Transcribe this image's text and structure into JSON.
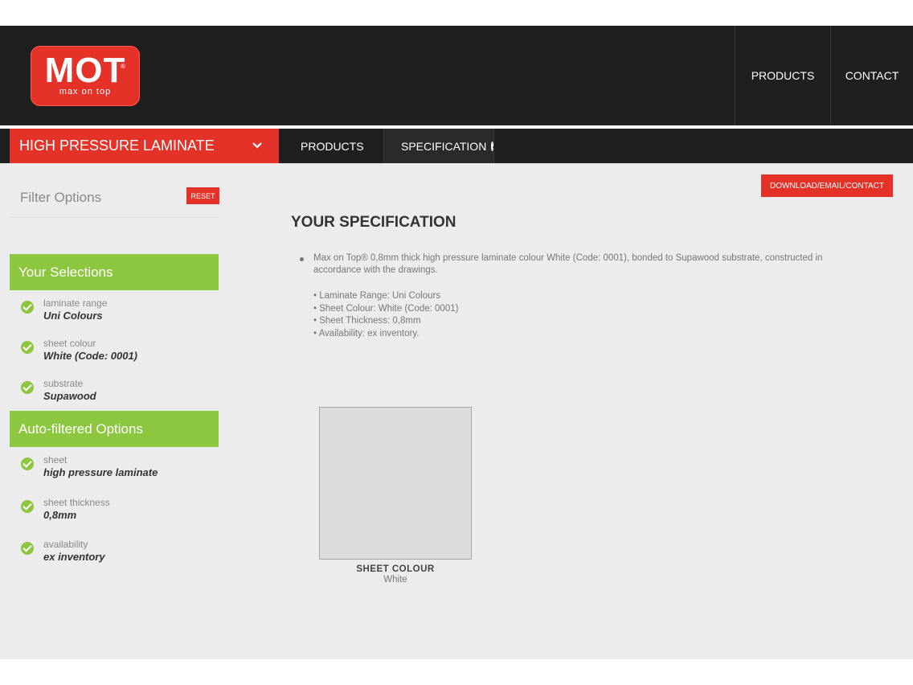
{
  "brand": {
    "logo_text": "MOT",
    "logo_registered": "®",
    "logo_tagline": "max on top",
    "brand_color": "#e53228",
    "accent_green": "#8dc63f"
  },
  "top_nav": {
    "products": "PRODUCTS",
    "contact": "CONTACT"
  },
  "sub_nav": {
    "range": "HIGH PRESSURE LAMINATE",
    "range_icon": "chevron-down-icon",
    "products": "PRODUCTS",
    "specification": "SPECIFICATION",
    "specification_icon": "check-circle-icon"
  },
  "sidebar": {
    "filter_title": "Filter Options",
    "reset": "RESET",
    "your_selections": {
      "heading": "Your Selections",
      "items": [
        {
          "label": "laminate range",
          "value": "Uni Colours"
        },
        {
          "label": "sheet colour",
          "value": "White (Code: 0001)"
        },
        {
          "label": "substrate",
          "value": "Supawood"
        }
      ]
    },
    "auto_filtered": {
      "heading": "Auto-filtered Options",
      "items": [
        {
          "label": "sheet",
          "value": "high pressure laminate"
        },
        {
          "label": "sheet thickness",
          "value": "0,8mm"
        },
        {
          "label": "availability",
          "value": "ex inventory"
        }
      ]
    }
  },
  "main": {
    "download_button": "DOWNLOAD/EMAIL/CONTACT",
    "title": "YOUR SPECIFICATION",
    "description": "Max on Top® 0,8mm thick high pressure laminate colour White (Code: 0001), bonded to Supawood substrate, constructed in accordance with the drawings.",
    "details": [
      "• Laminate Range: Uni Colours",
      "• Sheet Colour: White (Code: 0001)",
      "• Sheet Thickness: 0,8mm",
      "• Availability: ex inventory."
    ],
    "swatch": {
      "title": "SHEET COLOUR",
      "value": "White",
      "color": "#dcdcdc"
    }
  }
}
